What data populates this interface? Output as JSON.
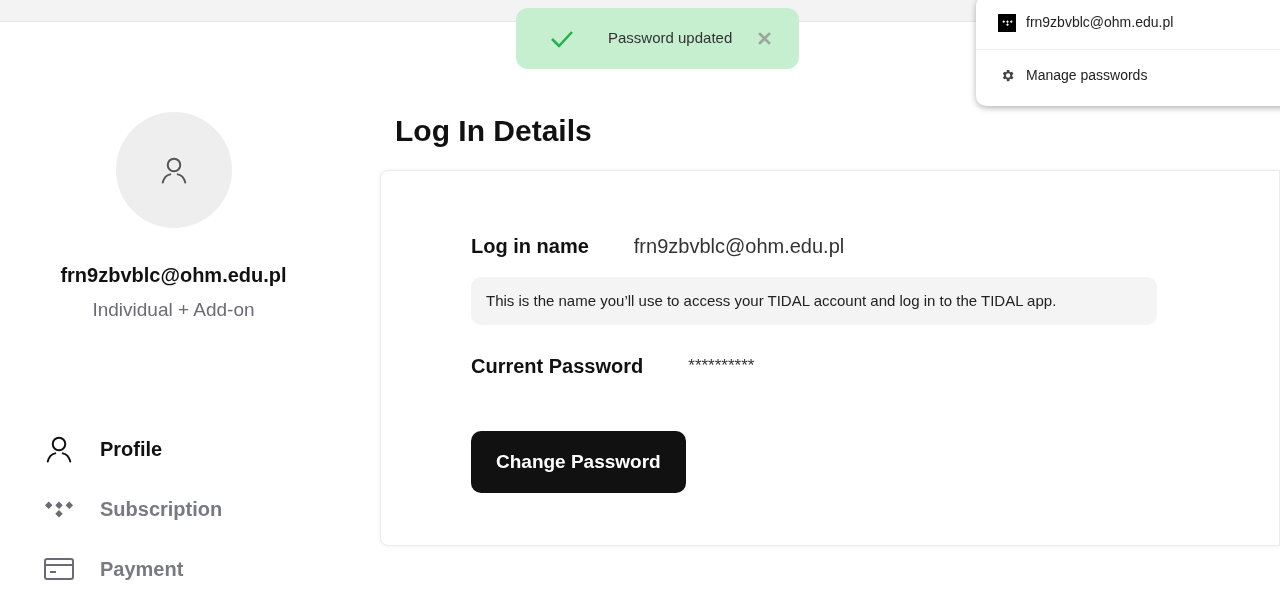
{
  "toast": {
    "message": "Password updated"
  },
  "password_popup": {
    "account": "frn9zbvblc@ohm.edu.pl",
    "manage": "Manage passwords"
  },
  "profile": {
    "email": "frn9zbvblc@ohm.edu.pl",
    "plan": "Individual + Add-on"
  },
  "nav": [
    {
      "kind": "person",
      "label": "Profile",
      "selected": true
    },
    {
      "kind": "tidal",
      "label": "Subscription",
      "selected": false
    },
    {
      "kind": "card",
      "label": "Payment",
      "selected": false
    }
  ],
  "title": "Log In Details",
  "login": {
    "label": "Log in name",
    "value": "frn9zbvblc@ohm.edu.pl",
    "note": "This is the name you’ll use to access your TIDAL account and log in to the TIDAL app."
  },
  "password": {
    "label": "Current Password",
    "value": "**********"
  },
  "button": "Change Password"
}
